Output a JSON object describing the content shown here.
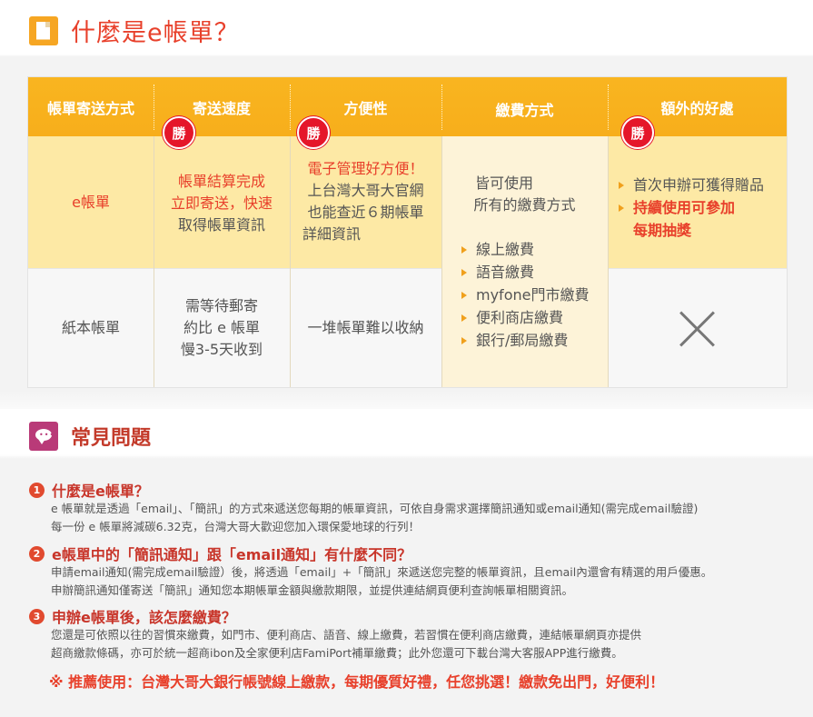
{
  "sections": {
    "title1": "什麼是e帳單？",
    "title2": "常見問題"
  },
  "table": {
    "headers": [
      "帳單寄送方式",
      "寄送速度",
      "方便性",
      "繳費方式",
      "額外的好處"
    ],
    "win_badge": "勝",
    "ebill": {
      "name": "e帳單",
      "speed": [
        "帳單結算完成",
        "立即寄送，快速",
        "取得帳單資訊"
      ],
      "convenience_red": "電子管理好方便！",
      "convenience": [
        "上台灣大哥大官網",
        "也能查近６期帳單",
        "詳細資訊"
      ],
      "extras": [
        {
          "text": "首次申辦可獲得贈品",
          "bold": false
        },
        {
          "text": "持續使用可參加",
          "bold": true
        }
      ],
      "extras_cont": "每期抽獎"
    },
    "paper": {
      "name": "紙本帳單",
      "speed": [
        "需等待郵寄",
        "約比 e 帳單",
        "慢3-5天收到"
      ],
      "convenience": "一堆帳單難以收納"
    },
    "payment": {
      "intro": [
        "皆可使用",
        "所有的繳費方式"
      ],
      "methods": [
        "線上繳費",
        "語音繳費",
        "myfone門市繳費",
        "便利商店繳費",
        "銀行/郵局繳費"
      ]
    }
  },
  "faq": [
    {
      "num": "1",
      "question": "什麼是e帳單？",
      "answer": [
        "e 帳單就是透過「email」、「簡訊」的方式來遞送您每期的帳單資訊，可依自身需求選擇簡訊通知或email通知(需完成email驗證)",
        "每一份 e 帳單將減碳6.32克，台灣大哥大歡迎您加入環保愛地球的行列！"
      ]
    },
    {
      "num": "2",
      "question": "e帳單中的「簡訊通知」跟「email通知」有什麼不同？",
      "answer": [
        "申請email通知(需完成email驗證）後，將透過「email」+「簡訊」來遞送您完整的帳單資訊，且email內還會有精選的用戶優惠。",
        "申辦簡訊通知僅寄送「簡訊」通知您本期帳單金額與繳款期限，並提供連結網頁便利查詢帳單相關資訊。"
      ]
    },
    {
      "num": "3",
      "question": "申辦e帳單後，該怎麼繳費？",
      "answer": [
        "您還是可依照以往的習慣來繳費，如門市、便利商店、語音、線上繳費，若習慣在便利商店繳費，連結帳單網頁亦提供",
        "超商繳款條碼，亦可於統一超商ibon及全家便利店FamiPort補單繳費；此外您還可下載台灣大客服APP進行繳費。"
      ]
    }
  ],
  "recommend": "※ 推薦使用：台灣大哥大銀行帳號線上繳款，每期優質好禮，任您挑選！繳款免出門，好便利！",
  "colors": {
    "header_orange": "#f9b520",
    "title_red": "#e8402b",
    "win_red": "#e5162a",
    "ebill_row": "#fde9a5"
  },
  "icons": [
    "document-icon",
    "chat-icon",
    "close-x-icon",
    "bullet-arrow-icon"
  ]
}
